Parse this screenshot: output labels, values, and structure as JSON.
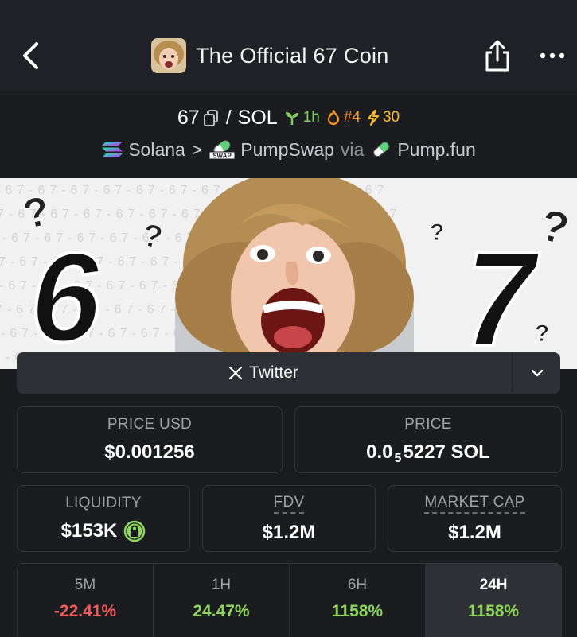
{
  "header": {
    "title": "The Official 67 Coin"
  },
  "pair": {
    "base": "67",
    "separator": "/",
    "quote": "SOL",
    "age": "1h",
    "rank": "#4",
    "boosts": "30"
  },
  "chain": {
    "network": "Solana",
    "separator": ">",
    "dex": "PumpSwap",
    "dex_badge": "SWAP",
    "via": "via",
    "launchpad": "Pump.fun"
  },
  "banner": {
    "left_digit": "6",
    "right_digit": "7",
    "pattern_text": "7-67-67-67-67-67-67-67-67-67-67-67-67"
  },
  "links": {
    "twitter_label": "Twitter"
  },
  "stats": {
    "price_usd_label": "PRICE USD",
    "price_usd_value": "$0.001256",
    "price_label": "PRICE",
    "price_value_prefix": "0.0",
    "price_value_sub": "5",
    "price_value_suffix": "5227 SOL",
    "liquidity_label": "LIQUIDITY",
    "liquidity_value": "$153K",
    "fdv_label": "FDV",
    "fdv_value": "$1.2M",
    "mcap_label": "MARKET CAP",
    "mcap_value": "$1.2M"
  },
  "timeframes": [
    {
      "label": "5M",
      "value": "-22.41%"
    },
    {
      "label": "1H",
      "value": "24.47%"
    },
    {
      "label": "6H",
      "value": "1158%"
    },
    {
      "label": "24H",
      "value": "1158%"
    }
  ],
  "colors": {
    "background": "#1b1c20",
    "header": "#202126",
    "negative": "#f25b5b",
    "positive": "#8ed65b",
    "lock_green": "#8ed65b"
  }
}
